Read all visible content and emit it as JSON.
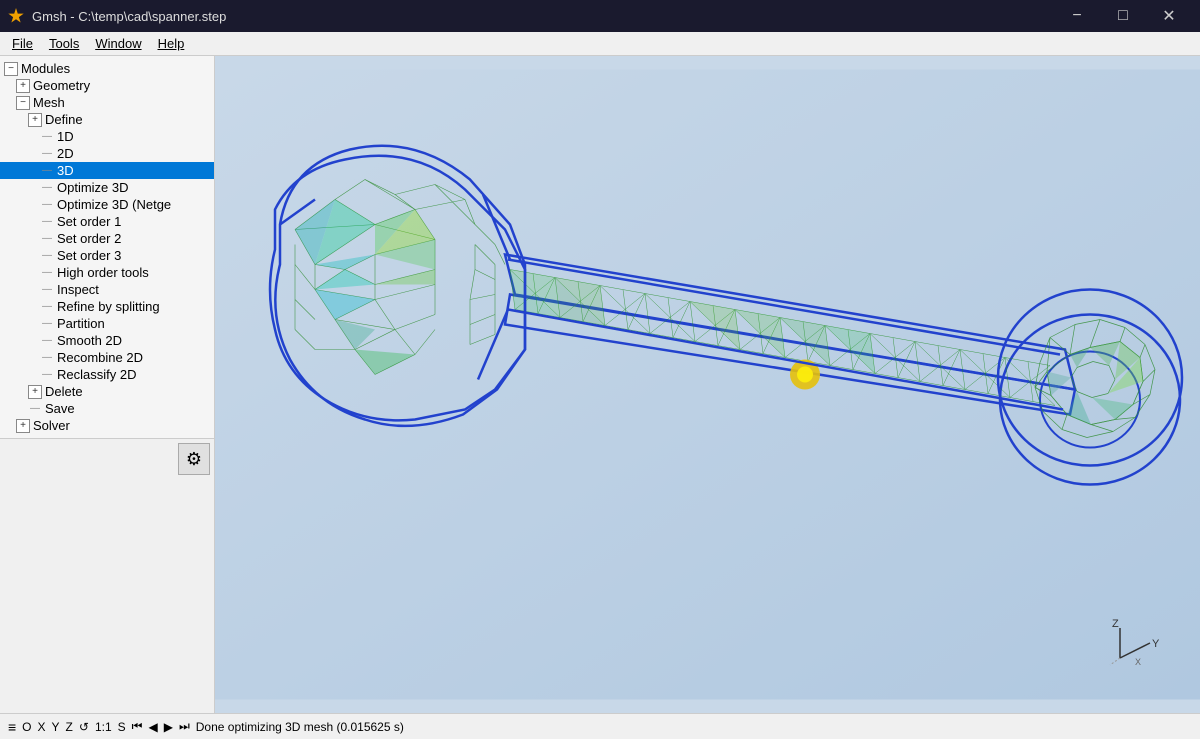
{
  "titlebar": {
    "icon": "gmsh-icon",
    "title": "Gmsh - C:\\temp\\cad\\spanner.step",
    "minimize_label": "−",
    "maximize_label": "□",
    "close_label": "✕"
  },
  "menubar": {
    "items": [
      {
        "id": "file",
        "label": "File"
      },
      {
        "id": "tools",
        "label": "Tools"
      },
      {
        "id": "window",
        "label": "Window"
      },
      {
        "id": "help",
        "label": "Help"
      }
    ]
  },
  "sidebar": {
    "gear_label": "⚙",
    "tree": [
      {
        "id": "modules",
        "label": "Modules",
        "indent": 0,
        "type": "expand",
        "icon": "−"
      },
      {
        "id": "geometry",
        "label": "Geometry",
        "indent": 1,
        "type": "expand",
        "icon": "+"
      },
      {
        "id": "mesh",
        "label": "Mesh",
        "indent": 1,
        "type": "expand",
        "icon": "−"
      },
      {
        "id": "define",
        "label": "Define",
        "indent": 2,
        "type": "expand",
        "icon": "+"
      },
      {
        "id": "1d",
        "label": "1D",
        "indent": 3,
        "type": "dash"
      },
      {
        "id": "2d",
        "label": "2D",
        "indent": 3,
        "type": "dash"
      },
      {
        "id": "3d",
        "label": "3D",
        "indent": 3,
        "type": "dash",
        "selected": true
      },
      {
        "id": "optimize3d",
        "label": "Optimize 3D",
        "indent": 3,
        "type": "dash"
      },
      {
        "id": "optimize3d-netgen",
        "label": "Optimize 3D (Netge",
        "indent": 3,
        "type": "dash"
      },
      {
        "id": "set-order-1",
        "label": "Set order 1",
        "indent": 3,
        "type": "dash"
      },
      {
        "id": "set-order-2",
        "label": "Set order 2",
        "indent": 3,
        "type": "dash"
      },
      {
        "id": "set-order-3",
        "label": "Set order 3",
        "indent": 3,
        "type": "dash"
      },
      {
        "id": "high-order-tools",
        "label": "High order tools",
        "indent": 3,
        "type": "dash"
      },
      {
        "id": "inspect",
        "label": "Inspect",
        "indent": 3,
        "type": "dash"
      },
      {
        "id": "refine-by-splitting",
        "label": "Refine by splitting",
        "indent": 3,
        "type": "dash"
      },
      {
        "id": "partition",
        "label": "Partition",
        "indent": 3,
        "type": "dash"
      },
      {
        "id": "smooth-2d",
        "label": "Smooth 2D",
        "indent": 3,
        "type": "dash"
      },
      {
        "id": "recombine-2d",
        "label": "Recombine 2D",
        "indent": 3,
        "type": "dash"
      },
      {
        "id": "reclassify-2d",
        "label": "Reclassify 2D",
        "indent": 3,
        "type": "dash"
      },
      {
        "id": "delete",
        "label": "Delete",
        "indent": 2,
        "type": "expand",
        "icon": "+"
      },
      {
        "id": "save",
        "label": "Save",
        "indent": 2,
        "type": "dash"
      },
      {
        "id": "solver",
        "label": "Solver",
        "indent": 1,
        "type": "expand",
        "icon": "+"
      }
    ]
  },
  "statusbar": {
    "icons": [
      "≡",
      "O",
      "X",
      "Y",
      "Z",
      "↺",
      "1:1",
      "S"
    ],
    "nav_icons": [
      "⏮",
      "◀",
      "▶",
      "⏭"
    ],
    "message": "Done optimizing 3D mesh (0.015625 s)"
  },
  "viewport": {
    "background_color": "#c8d8e8"
  }
}
